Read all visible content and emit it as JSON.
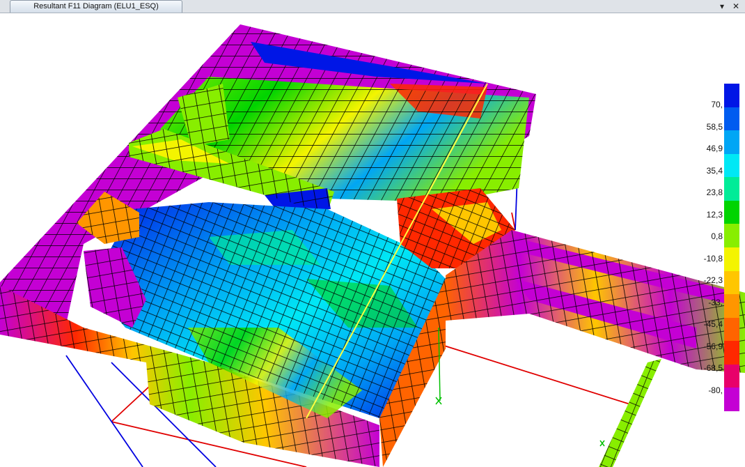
{
  "window": {
    "tab_title": "Resultant F11 Diagram (ELU1_ESQ)",
    "dropdown_icon": "chevron-down-icon",
    "close_icon": "close-icon"
  },
  "legend": {
    "labels": [
      "70,",
      "58,5",
      "46,9",
      "35,4",
      "23,8",
      "12,3",
      "0,8",
      "-10,8",
      "-22,3",
      "-33,",
      "-45,4",
      "-56,9",
      "-68,5",
      "-80,"
    ],
    "colors": [
      "#0016e6",
      "#005cf0",
      "#00a6f5",
      "#00e8f5",
      "#00ec98",
      "#00d400",
      "#88ee00",
      "#f4f400",
      "#ffc600",
      "#ff9600",
      "#ff6400",
      "#ff2800",
      "#e8006a",
      "#c400d4"
    ]
  },
  "colors": {
    "mesh_line": "#000000",
    "support_red": "#e00000",
    "support_blue": "#0000e0",
    "axis_yellow": "#ffff40"
  }
}
